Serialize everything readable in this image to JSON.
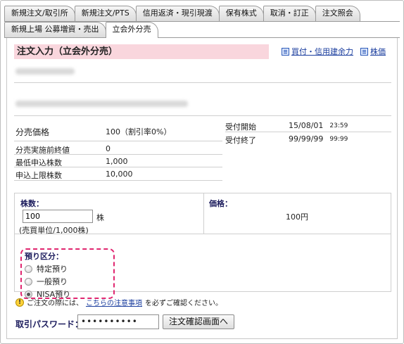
{
  "tabs": {
    "row1": [
      "新規注文/取引所",
      "新規注文/PTS",
      "信用返済・現引現渡",
      "保有株式",
      "取消・訂正",
      "注文照会"
    ],
    "row2": [
      "新規上場 公募増資・売出",
      "立会外分売"
    ],
    "active": "立会外分売"
  },
  "header": {
    "title": "注文入力（立会外分売）",
    "links": [
      "買付・信用建余力",
      "株価"
    ]
  },
  "info": {
    "price_label": "分売価格",
    "price_value": "100（割引率0%）",
    "start_label": "受付開始",
    "start_date": "15/08/01",
    "start_time": "23:59",
    "end_label": "受付終了",
    "end_date": "99/99/99",
    "end_time": "99:99",
    "prev_close_label": "分売実施前終値",
    "prev_close_value": "0",
    "min_qty_label": "最低申込株数",
    "min_qty_value": "1,000",
    "max_qty_label": "申込上限株数",
    "max_qty_value": "10,000"
  },
  "form": {
    "qty_title": "株数：",
    "qty_value": "100",
    "qty_unit": "株",
    "unit_note": "(売買単位/1,000株)",
    "price_title": "価格：",
    "price_value": "100円",
    "account_title": "預り区分：",
    "account_options": [
      "特定預り",
      "一般預り",
      "NISA預り"
    ],
    "account_selected": "NISA預り"
  },
  "notice": {
    "prefix": "ご注文の際には、",
    "link": "こちらの注意事項",
    "suffix": "を必ずご確認ください。"
  },
  "password": {
    "label": "取引パスワード：",
    "masked_value": "••••••••••",
    "button": "注文確認画面へ"
  },
  "colors": {
    "title_bg": "#f9d6dd",
    "highlight_dash": "#e0266f",
    "label_navy": "#1d1d5e",
    "link_blue": "#1a3d9e"
  }
}
